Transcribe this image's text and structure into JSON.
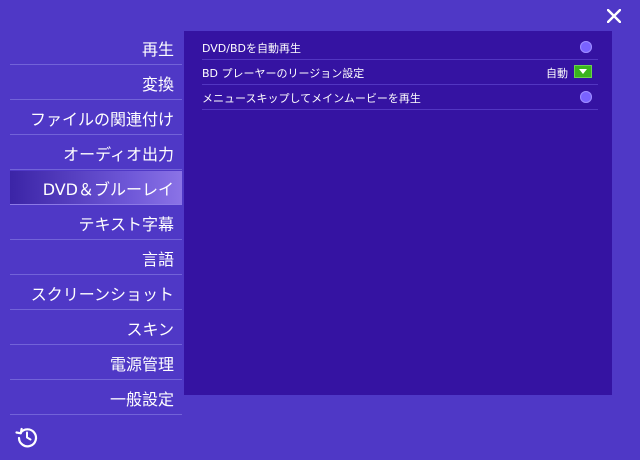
{
  "window": {
    "close_icon": "close-icon",
    "history_icon": "history-icon"
  },
  "sidebar": {
    "items": [
      {
        "label": "再生"
      },
      {
        "label": "変換"
      },
      {
        "label": "ファイルの関連付け"
      },
      {
        "label": "オーディオ出力"
      },
      {
        "label": "DVD＆ブルーレイ",
        "active": true
      },
      {
        "label": "テキスト字幕"
      },
      {
        "label": "言語"
      },
      {
        "label": "スクリーンショット"
      },
      {
        "label": "スキン"
      },
      {
        "label": "電源管理"
      },
      {
        "label": "一般設定"
      }
    ]
  },
  "settings": {
    "auto_play_label": "DVD/BDを自動再生",
    "region_label": "BD プレーヤーのリージョン設定",
    "region_value": "自動",
    "skip_menu_label": "メニュースキップしてメインムービーを再生"
  },
  "colors": {
    "background": "#4f38c6",
    "panel": "#3513a2",
    "accent_radio": "#7a63ff",
    "dropdown_green": "#39b41e"
  }
}
